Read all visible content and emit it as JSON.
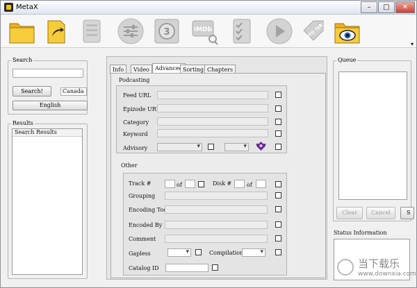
{
  "window": {
    "title": "MetaX",
    "controls": {
      "minimize": "–",
      "maximize": "□",
      "close": "✕"
    }
  },
  "toolbar": {
    "buttons": [
      "open-folder-icon",
      "open-file-icon",
      "document-icon",
      "settings-icon",
      "film-countdown-icon",
      "imdb-search-icon",
      "checklist-icon",
      "play-icon",
      "auto-tag-icon",
      "view-folder-icon"
    ],
    "imdb_text": "iMDb",
    "countdown_text": "3",
    "auto_tag_text": "AUTO TAG",
    "overflow": "▾"
  },
  "search": {
    "group_title": "Search",
    "query": "",
    "search_button": "Search!",
    "country": "Canada",
    "language_button": "English"
  },
  "results": {
    "group_title": "Results",
    "header": "Search Results"
  },
  "tabs": {
    "items": [
      "Info",
      "Video",
      "Advanced",
      "Sorting",
      "Chapters"
    ],
    "active": "Advanced"
  },
  "podcasting": {
    "title": "Podcasting",
    "fields": {
      "feed_url": "Feed URL",
      "episode_url": "Epizode URL",
      "category": "Category",
      "keyword": "Keyword",
      "advisory": "Advisory"
    }
  },
  "other": {
    "title": "Other",
    "track_label": "Track #",
    "track_of": "of",
    "disk_label": "Disk #",
    "disk_of": "of",
    "grouping": "Grouping",
    "encoding_tool": "Encoding Tool",
    "encoded_by": "Encoded By",
    "comment": "Comment",
    "gapless": "Gapless",
    "compilation": "Compilation",
    "catalog_id": "Catalog ID"
  },
  "queue": {
    "group_title": "Queue",
    "clear_button": "Clear",
    "cancel_button": "Cancel",
    "start_button": "S"
  },
  "status": {
    "group_title": "Status Information"
  },
  "watermark": {
    "cn_text": "当下载乐",
    "url": "www.downxia.com"
  },
  "colors": {
    "folder_yellow": "#f2c12e",
    "icon_grey": "#c9c9c9",
    "advisory_purple": "#6a2d91"
  }
}
